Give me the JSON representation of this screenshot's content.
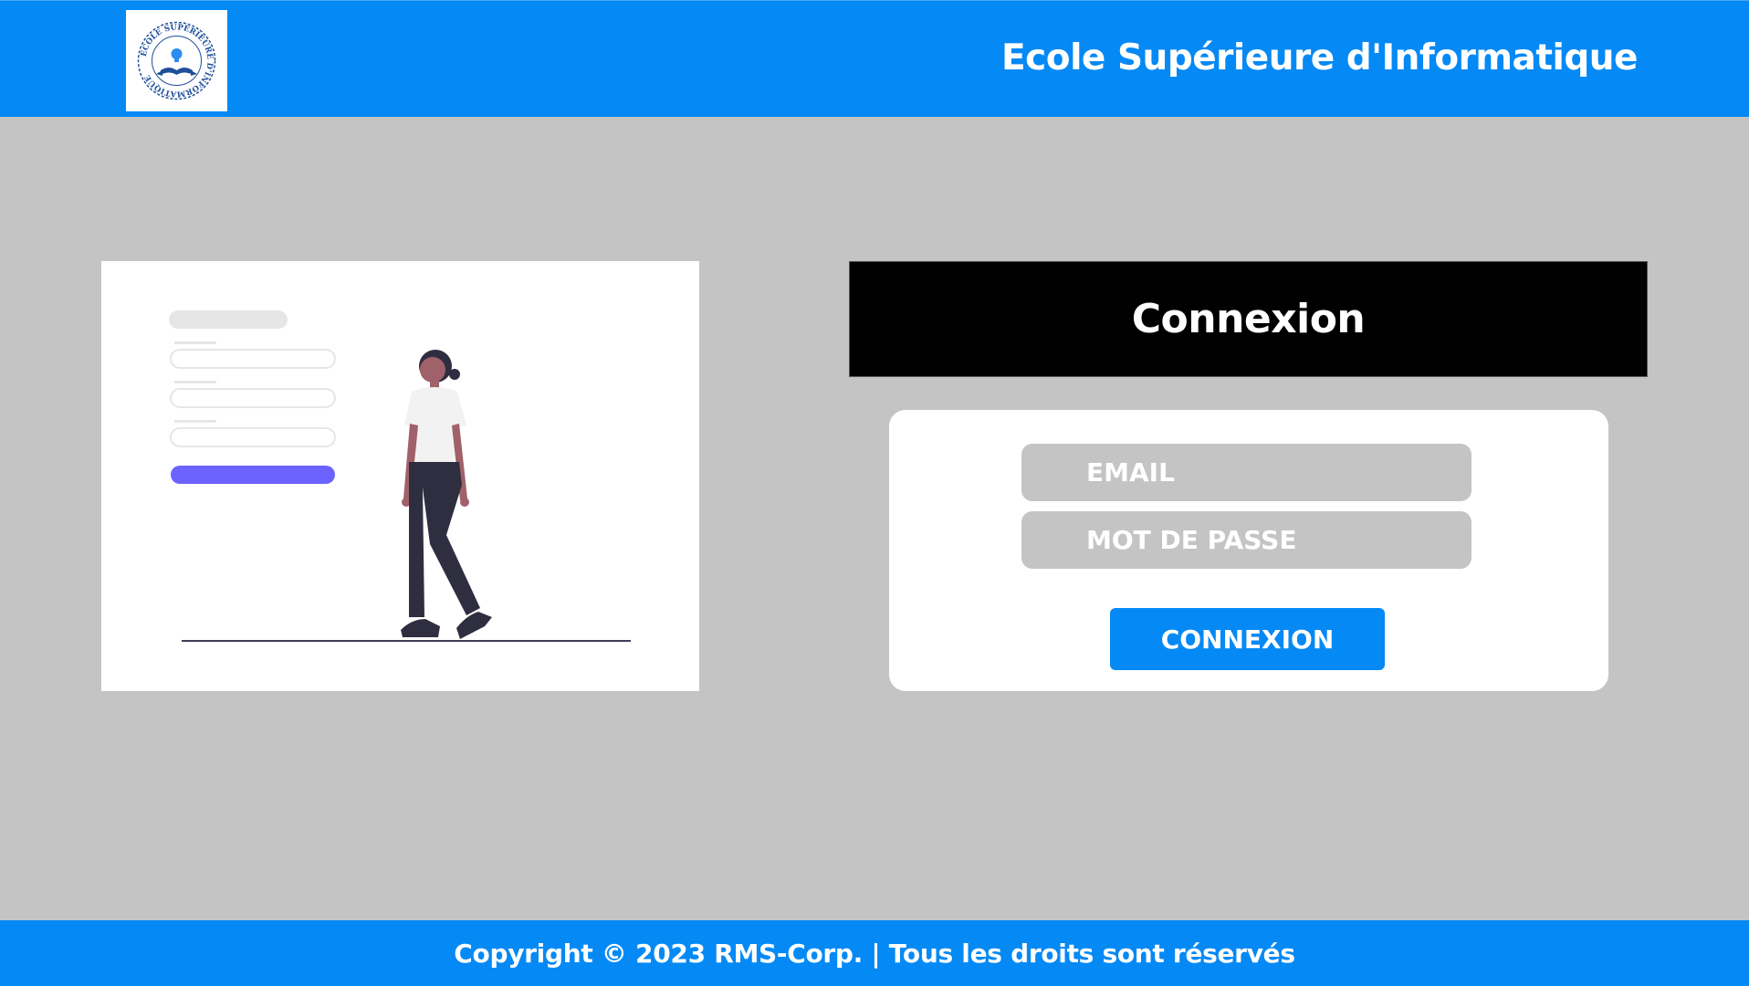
{
  "header": {
    "school_name": "Ecole Supérieure d'Informatique",
    "logo_text_top": "ECOLE SUPERIEURE D'INFORMATIQUE",
    "accent_color": "#0589f5"
  },
  "illustration": {
    "icon": "person-login-illustration",
    "accent_color": "#6c63ff"
  },
  "login": {
    "title": "Connexion",
    "email_placeholder": "EMAIL",
    "email_value": "",
    "password_placeholder": "MOT DE PASSE",
    "password_value": "",
    "submit_label": "CONNEXION"
  },
  "footer": {
    "copyright": "Copyright © 2023 RMS-Corp. | Tous les droits sont réservés"
  },
  "colors": {
    "background": "#c4c4c4",
    "brand": "#0589f5",
    "title_bar": "#000000"
  }
}
